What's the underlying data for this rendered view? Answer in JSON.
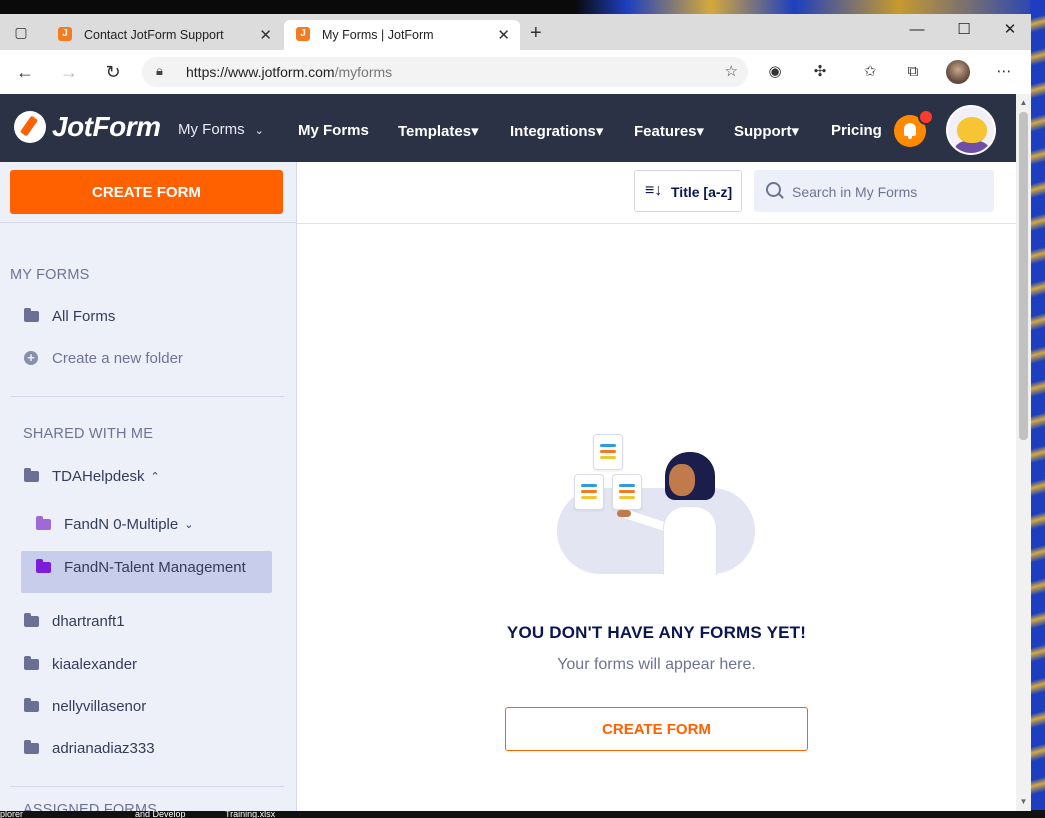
{
  "taskbar": {
    "items": [
      "plorer",
      "and Develop",
      "Training.xlsx"
    ]
  },
  "browser": {
    "tabs": [
      {
        "label": "Contact JotForm Support",
        "favicon": "jotform-favicon",
        "active": false
      },
      {
        "label": "My Forms | JotForm",
        "favicon": "jotform-favicon",
        "active": true
      }
    ],
    "url_host": "https://www.jotform.com",
    "url_path": "/myforms"
  },
  "header": {
    "logo_text": "JotForm",
    "context_dropdown": "My Forms",
    "nav": [
      "My Forms",
      "Templates",
      "Integrations",
      "Features",
      "Support",
      "Pricing"
    ],
    "dropdown_marker": "▾"
  },
  "sidebar": {
    "create_button": "CREATE FORM",
    "my_forms_title": "MY FORMS",
    "all_forms": "All Forms",
    "create_folder": "Create a new folder",
    "shared_title": "SHARED WITH ME",
    "shared": [
      {
        "label": "TDAHelpdesk",
        "caret": "⌃"
      },
      {
        "label": "FandN 0-Multiple",
        "caret": "⌄"
      },
      {
        "label": "FandN-Talent Management",
        "selected": true
      },
      {
        "label": "dhartranft1"
      },
      {
        "label": "kiaalexander"
      },
      {
        "label": "nellyvillasenor"
      },
      {
        "label": "adrianadiaz333"
      }
    ],
    "assigned_title": "ASSIGNED FORMS"
  },
  "toolbar": {
    "sort_label": "Title [a-z]",
    "search_placeholder": "Search in My Forms"
  },
  "empty_state": {
    "title": "YOU DON'T HAVE ANY FORMS YET!",
    "subtitle": "Your forms will appear here.",
    "button": "CREATE FORM"
  },
  "colors": {
    "header_bg": "#2b3245",
    "brand_orange": "#ff6100",
    "sidebar_bg": "#eef0f9",
    "selected_bg": "#c8cdec"
  }
}
